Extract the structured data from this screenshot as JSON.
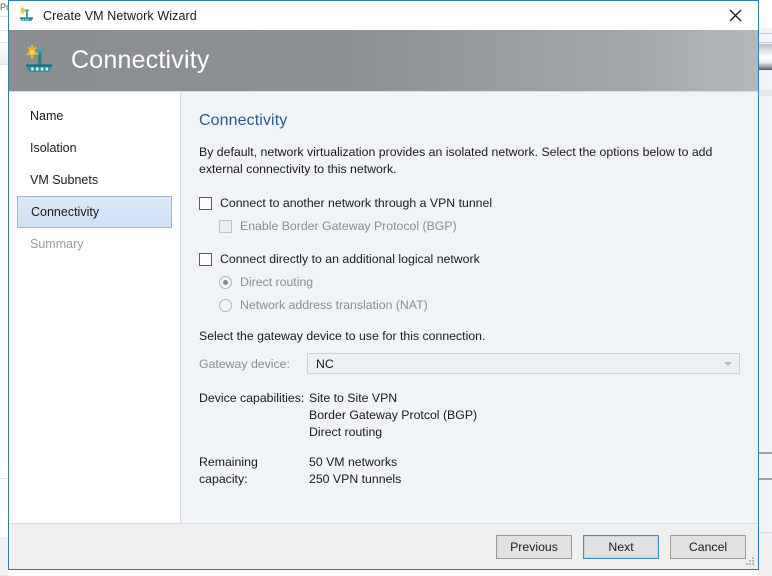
{
  "window": {
    "title": "Create VM Network Wizard",
    "title_icon": "vm-network-icon",
    "close_icon": "close-icon",
    "border_color": "#2e7ba6"
  },
  "header": {
    "title": "Connectivity",
    "icon": "vm-network-icon",
    "background_start": "#8a8e91",
    "background_end": "#b5b8bb"
  },
  "sidebar": {
    "items": [
      {
        "label": "Name",
        "state": "normal"
      },
      {
        "label": "Isolation",
        "state": "normal"
      },
      {
        "label": "VM Subnets",
        "state": "normal"
      },
      {
        "label": "Connectivity",
        "state": "selected"
      },
      {
        "label": "Summary",
        "state": "disabled"
      }
    ],
    "selected_bg": "#cfe0f4",
    "selected_border": "#9fb6ce"
  },
  "main": {
    "title": "Connectivity",
    "title_color": "#2a5a8c",
    "description": "By default, network virtualization provides an isolated network. Select the options below to add external connectivity to this network.",
    "options": [
      {
        "type": "checkbox",
        "label": "Connect to another network through a VPN tunnel",
        "checked": false,
        "disabled": false,
        "indent": false
      },
      {
        "type": "checkbox",
        "label": "Enable Border Gateway Protocol (BGP)",
        "checked": false,
        "disabled": true,
        "indent": true
      },
      {
        "type": "checkbox",
        "label": "Connect directly to an additional logical network",
        "checked": false,
        "disabled": false,
        "indent": false
      },
      {
        "type": "radio",
        "label": "Direct routing",
        "checked": true,
        "disabled": true,
        "indent": true
      },
      {
        "type": "radio",
        "label": "Network address translation (NAT)",
        "checked": false,
        "disabled": true,
        "indent": true
      }
    ],
    "gateway_prompt": "Select the gateway device to use for this connection.",
    "gateway_field": {
      "label": "Gateway device:",
      "value": "NC",
      "disabled": true,
      "arrow_icon": "chevron-down-icon"
    },
    "device_capabilities": {
      "label": "Device capabilities:",
      "values": [
        "Site to Site VPN",
        "Border Gateway Protcol (BGP)",
        "Direct routing"
      ]
    },
    "remaining_capacity": {
      "label": "Remaining capacity:",
      "values": [
        "50 VM networks",
        "250 VPN tunnels"
      ]
    }
  },
  "footer": {
    "buttons": [
      {
        "label": "Previous",
        "focused": false
      },
      {
        "label": "Next",
        "focused": true
      },
      {
        "label": "Cancel",
        "focused": false
      }
    ]
  }
}
